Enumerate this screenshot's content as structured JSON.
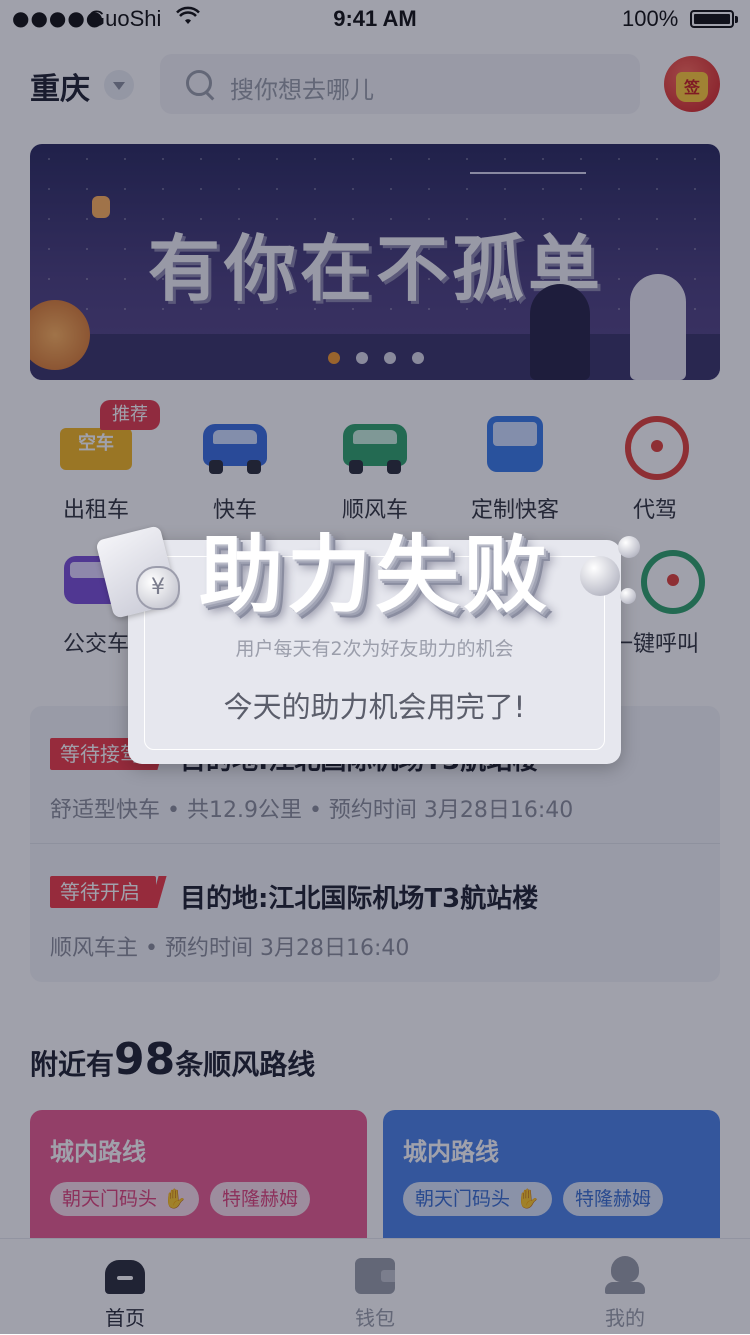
{
  "status_bar": {
    "signal": "●●●●●",
    "carrier": "GuoShi",
    "time": "9:41 AM",
    "battery_pct": "100%"
  },
  "header": {
    "city": "重庆",
    "search_placeholder": "搜你想去哪儿",
    "sign_label": "签"
  },
  "banner": {
    "headline": "有你在不孤单",
    "page_count": 4,
    "active_page": 0
  },
  "services": [
    {
      "label": "出租车",
      "badge": "推荐",
      "sign": "空车"
    },
    {
      "label": "快车"
    },
    {
      "label": "顺风车"
    },
    {
      "label": "定制快客"
    },
    {
      "label": "代驾"
    },
    {
      "label": "公交车"
    },
    {
      "label": "一键呼叫"
    }
  ],
  "orders": [
    {
      "status": "等待接驾",
      "title": "目的地:江北国际机场T3航站楼",
      "detail": "舒适型快车 • 共12.9公里 • 预约时间 3月28日16:40"
    },
    {
      "status": "等待开启",
      "title": "目的地:江北国际机场T3航站楼",
      "detail": "顺风车主 • 预约时间 3月28日16:40"
    }
  ],
  "nearby": {
    "prefix": "附近有",
    "count": "98",
    "suffix": "条顺风路线"
  },
  "route_cards": [
    {
      "title": "城内路线",
      "chips": [
        "朝天门码头",
        "特隆赫姆"
      ],
      "color": "#ea5d8f"
    },
    {
      "title": "城内路线",
      "chips": [
        "朝天门码头",
        "特隆赫姆"
      ],
      "color": "#4c83e6"
    }
  ],
  "tabbar": [
    {
      "label": "首页",
      "active": true
    },
    {
      "label": "钱包",
      "active": false
    },
    {
      "label": "我的",
      "active": false
    }
  ],
  "modal": {
    "title": "助力失败",
    "subtitle": "用户每天有2次为好友助力的机会",
    "message": "今天的助力机会用完了!",
    "coin_symbol": "¥"
  },
  "colors": {
    "accent_red": "#ef3b46",
    "taxi_yellow": "#f5b820",
    "blue": "#3a7ce8",
    "green": "#2fa36b",
    "purple": "#7b4fd6",
    "overlay": "rgba(18,20,44,0.40)"
  }
}
